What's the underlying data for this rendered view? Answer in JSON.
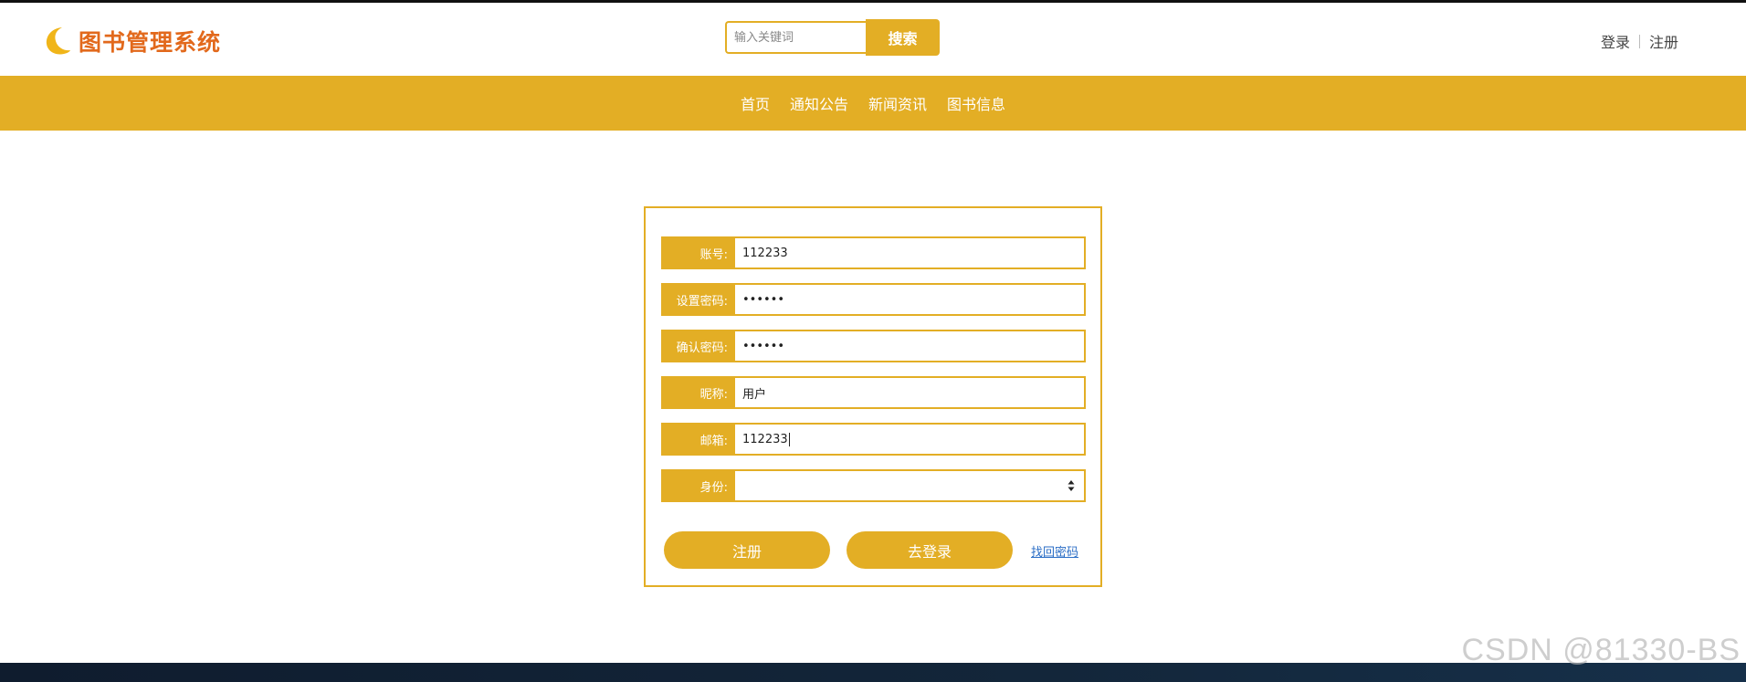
{
  "header": {
    "logo_text": "图书管理系统",
    "search": {
      "placeholder": "输入关键词",
      "button_label": "搜索"
    },
    "login_link": "登录",
    "register_link": "注册"
  },
  "nav": {
    "items": [
      {
        "label": "首页"
      },
      {
        "label": "通知公告"
      },
      {
        "label": "新闻资讯"
      },
      {
        "label": "图书信息"
      }
    ]
  },
  "form": {
    "fields": [
      {
        "label": "账号:",
        "value": "112233"
      },
      {
        "label": "设置密码:",
        "value": "••••••"
      },
      {
        "label": "确认密码:",
        "value": "••••••"
      },
      {
        "label": "昵称:",
        "value": "用户"
      },
      {
        "label": "邮箱:",
        "value": "112233"
      },
      {
        "label": "身份:",
        "value": ""
      }
    ],
    "register_button": "注册",
    "login_button": "去登录",
    "find_password_link": "找回密码"
  },
  "watermark": "CSDN @81330-BS",
  "colors": {
    "accent": "#e3ae25",
    "logo": "#e2691c",
    "link": "#2b6ec6"
  }
}
